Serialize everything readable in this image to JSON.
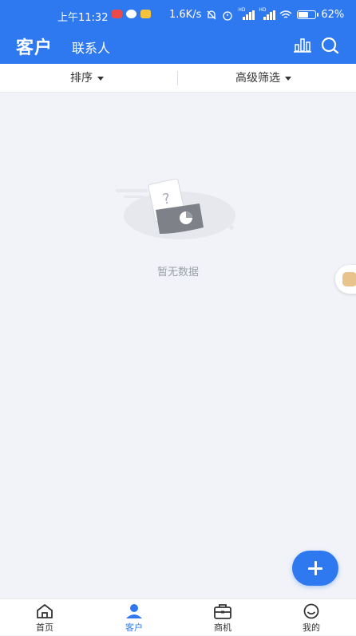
{
  "status_bar": {
    "time": "上午11:32",
    "net_speed": "1.6K/s",
    "signal_1_label": "HD",
    "signal_2_label": "HD",
    "battery": "62%"
  },
  "header": {
    "title": "客户",
    "tab_contacts": "联系人",
    "icons": [
      "chart-icon",
      "search-icon"
    ],
    "bg_color": "#2f79f0"
  },
  "filters": {
    "sort_label": "排序",
    "advanced_filter_label": "高级筛选"
  },
  "empty_state": {
    "text": "暂无数据",
    "illustration_mark": "?"
  },
  "fab": {
    "icon": "plus-icon"
  },
  "tabbar": {
    "items": [
      {
        "label": "首页",
        "icon": "home-icon",
        "active": false
      },
      {
        "label": "客户",
        "icon": "person-icon",
        "active": true
      },
      {
        "label": "商机",
        "icon": "briefcase-icon",
        "active": false
      },
      {
        "label": "我的",
        "icon": "smile-icon",
        "active": false
      }
    ],
    "active_color": "#2f79f0"
  }
}
